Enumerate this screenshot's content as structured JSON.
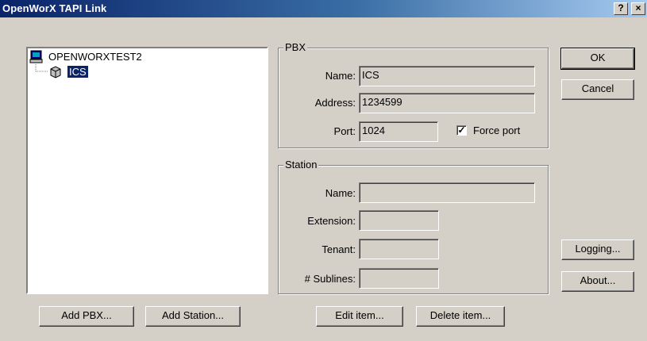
{
  "window": {
    "title": "OpenWorX TAPI Link",
    "help_button": "?",
    "close_button": "×"
  },
  "tree": {
    "root_label": "OPENWORXTEST2",
    "child_label": "ICS"
  },
  "pbx_group": {
    "legend": "PBX",
    "name_label": "Name:",
    "name_value": "ICS",
    "address_label": "Address:",
    "address_value": "1234599",
    "port_label": "Port:",
    "port_value": "1024",
    "force_port_label": "Force port",
    "force_port_checked": true
  },
  "station_group": {
    "legend": "Station",
    "name_label": "Name:",
    "name_value": "",
    "extension_label": "Extension:",
    "extension_value": "",
    "tenant_label": "Tenant:",
    "tenant_value": "",
    "sublines_label": "# Sublines:",
    "sublines_value": ""
  },
  "buttons": {
    "ok": "OK",
    "cancel": "Cancel",
    "logging": "Logging...",
    "about": "About...",
    "add_pbx": "Add PBX...",
    "add_station": "Add Station...",
    "edit_item": "Edit item...",
    "delete_item": "Delete item..."
  }
}
